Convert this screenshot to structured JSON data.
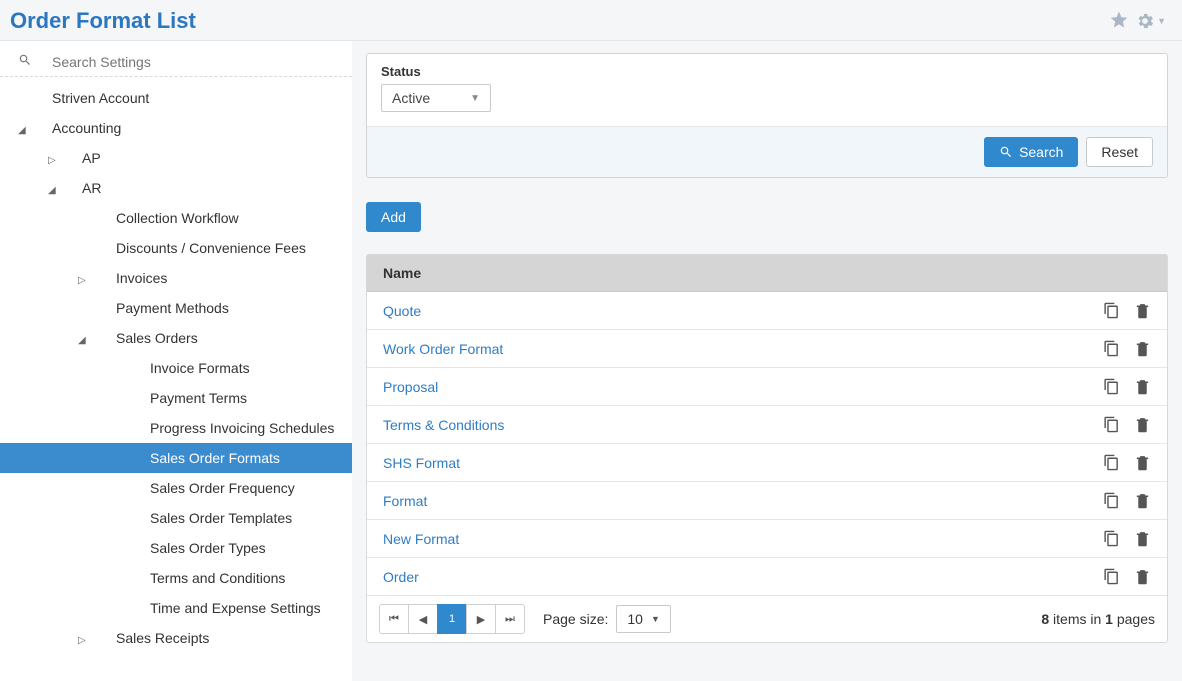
{
  "header": {
    "title": "Order Format List"
  },
  "search": {
    "placeholder": "Search Settings"
  },
  "tree": [
    {
      "label": "Striven Account",
      "level": 0,
      "caret": "",
      "selected": false
    },
    {
      "label": "Accounting",
      "level": 1,
      "caret": "down",
      "selected": false
    },
    {
      "label": "AP",
      "level": 2,
      "caret": "right",
      "selected": false
    },
    {
      "label": "AR",
      "level": 2,
      "caret": "down",
      "selected": false
    },
    {
      "label": "Collection Workflow",
      "level": 3,
      "caret": "",
      "selected": false
    },
    {
      "label": "Discounts / Convenience Fees",
      "level": 3,
      "caret": "",
      "selected": false
    },
    {
      "label": "Invoices",
      "level": 3,
      "caret": "right",
      "selected": false
    },
    {
      "label": "Payment Methods",
      "level": 3,
      "caret": "",
      "selected": false
    },
    {
      "label": "Sales Orders",
      "level": 3,
      "caret": "down",
      "selected": false
    },
    {
      "label": "Invoice Formats",
      "level": 4,
      "caret": "",
      "selected": false
    },
    {
      "label": "Payment Terms",
      "level": 4,
      "caret": "",
      "selected": false
    },
    {
      "label": "Progress Invoicing Schedules",
      "level": 4,
      "caret": "",
      "selected": false
    },
    {
      "label": "Sales Order Formats",
      "level": 4,
      "caret": "",
      "selected": true
    },
    {
      "label": "Sales Order Frequency",
      "level": 4,
      "caret": "",
      "selected": false
    },
    {
      "label": "Sales Order Templates",
      "level": 4,
      "caret": "",
      "selected": false
    },
    {
      "label": "Sales Order Types",
      "level": 4,
      "caret": "",
      "selected": false
    },
    {
      "label": "Terms and Conditions",
      "level": 4,
      "caret": "",
      "selected": false
    },
    {
      "label": "Time and Expense Settings",
      "level": 4,
      "caret": "",
      "selected": false
    },
    {
      "label": "Sales Receipts",
      "level": 3,
      "caret": "right",
      "selected": false
    }
  ],
  "filter": {
    "status_label": "Status",
    "status_value": "Active",
    "search_label": "Search",
    "reset_label": "Reset"
  },
  "actions": {
    "add_label": "Add"
  },
  "table": {
    "header": "Name",
    "rows": [
      {
        "name": "Quote"
      },
      {
        "name": "Work Order Format"
      },
      {
        "name": "Proposal"
      },
      {
        "name": "Terms & Conditions"
      },
      {
        "name": "SHS Format"
      },
      {
        "name": "Format"
      },
      {
        "name": "New Format"
      },
      {
        "name": "Order"
      }
    ]
  },
  "pager": {
    "current_page": "1",
    "page_size_label": "Page size:",
    "page_size_value": "10",
    "total_items": "8",
    "total_pages": "1",
    "summary_mid": " items in ",
    "summary_end": " pages"
  }
}
